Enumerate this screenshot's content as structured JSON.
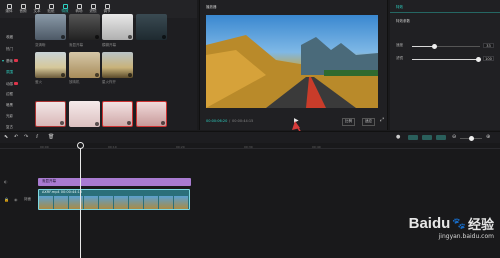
{
  "toolbar": {
    "tools": [
      {
        "label": "媒体",
        "icon": "media-icon"
      },
      {
        "label": "音频",
        "icon": "audio-icon"
      },
      {
        "label": "文本",
        "icon": "text-icon"
      },
      {
        "label": "贴纸",
        "icon": "sticker-icon"
      },
      {
        "label": "特效",
        "icon": "effects-icon"
      },
      {
        "label": "转场",
        "icon": "transition-icon"
      },
      {
        "label": "滤镜",
        "icon": "filter-icon"
      },
      {
        "label": "调节",
        "icon": "adjust-icon"
      }
    ],
    "active_index": 4
  },
  "sidebar": {
    "items": [
      "收藏",
      "热门",
      "基础",
      "氛围",
      "动感",
      "边框",
      "暗黑",
      "光影",
      "复古"
    ],
    "active_index": 3
  },
  "grid": {
    "thumb_labels": [
      "变清晰",
      "渐显开幕",
      "模糊开幕",
      "萤火",
      "放映机",
      "星火炸开",
      "",
      "",
      "",
      ""
    ]
  },
  "player": {
    "title": "播放器",
    "time_current": "00:00:06:20",
    "time_total": "00:00:44:15",
    "ratio_label": "比例",
    "fit_label": "适应"
  },
  "props": {
    "header": "特效",
    "section": "特效参数",
    "params": [
      {
        "label": "速度",
        "value": "33",
        "level": 0.33
      },
      {
        "label": "滤镜",
        "value": "100",
        "level": 1.0
      }
    ]
  },
  "timeline": {
    "ruler": [
      "00:00",
      "00:10",
      "00:20",
      "00:30",
      "00:40"
    ],
    "text_clip_label": "渐显开幕",
    "video_clip_label": "AXRF.mp4  00:00:44:15",
    "track_label": "封面"
  },
  "watermark": {
    "brand": "Baidu",
    "cn": "经验",
    "url": "jingyan.baidu.com"
  },
  "colors": {
    "accent": "#2ed3c4",
    "text_clip": "#a97bd1",
    "hot": "#e0344a",
    "arrow": "#d63b3b"
  }
}
